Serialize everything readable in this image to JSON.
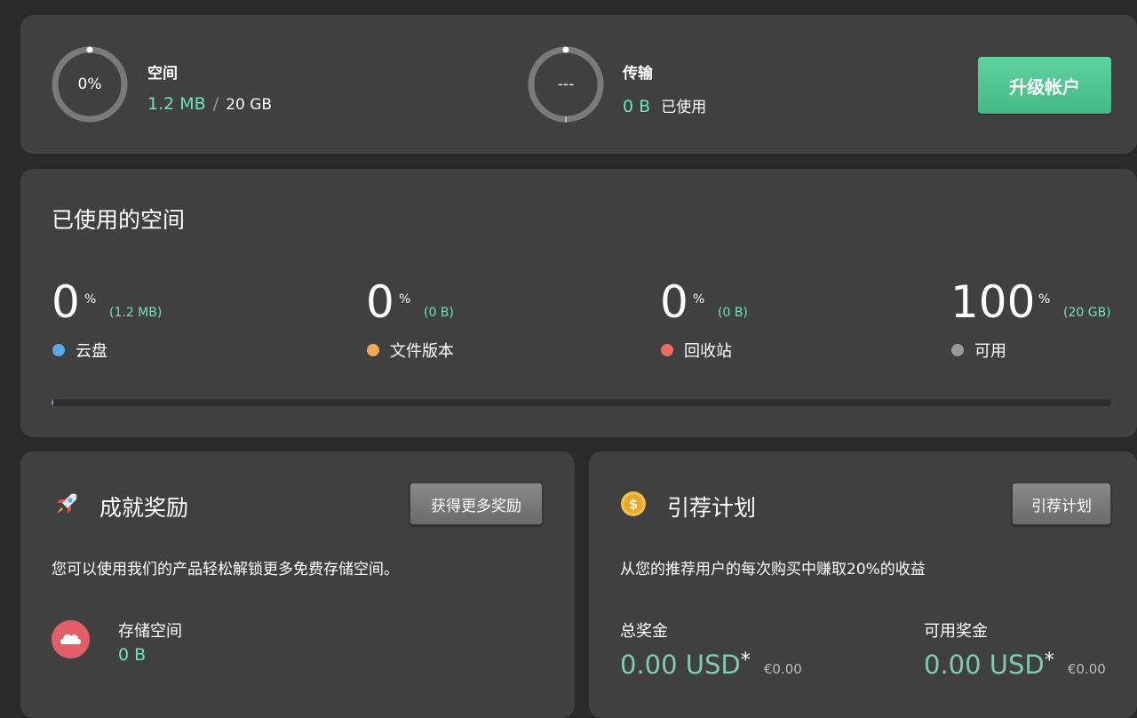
{
  "summary": {
    "space": {
      "ring_text": "0%",
      "label": "空间",
      "used": "1.2 MB",
      "sep": "/",
      "total": "20 GB",
      "fraction": 0.0
    },
    "transfer": {
      "ring_text": "---",
      "label": "传输",
      "used": "0 B",
      "suffix": "已使用"
    },
    "upgrade_label": "升级帐户"
  },
  "usage": {
    "title": "已使用的空间",
    "items": [
      {
        "value": "0",
        "unit": "%",
        "detail": "(1.2 MB)",
        "label": "云盘",
        "color": "#5aa9e6"
      },
      {
        "value": "0",
        "unit": "%",
        "detail": "(0 B)",
        "label": "文件版本",
        "color": "#f0a855"
      },
      {
        "value": "0",
        "unit": "%",
        "detail": "(0 B)",
        "label": "回收站",
        "color": "#ee6b60"
      },
      {
        "value": "100",
        "unit": "%",
        "detail": "(20 GB)",
        "label": "可用",
        "color": "#9a9a9a"
      }
    ]
  },
  "achievements": {
    "title": "成就奖励",
    "button_label": "获得更多奖励",
    "description": "您可以使用我们的产品轻松解锁更多免费存储空间。",
    "storage_label": "存储空间",
    "storage_value": "0 B"
  },
  "referral": {
    "title": "引荐计划",
    "button_label": "引荐计划",
    "description": "从您的推荐用户的每次购买中赚取20%的收益",
    "total_label": "总奖金",
    "total_value": "0.00 USD",
    "total_star": "*",
    "total_eur": "€0.00",
    "available_label": "可用奖金",
    "available_value": "0.00 USD",
    "available_star": "*",
    "available_eur": "€0.00"
  }
}
